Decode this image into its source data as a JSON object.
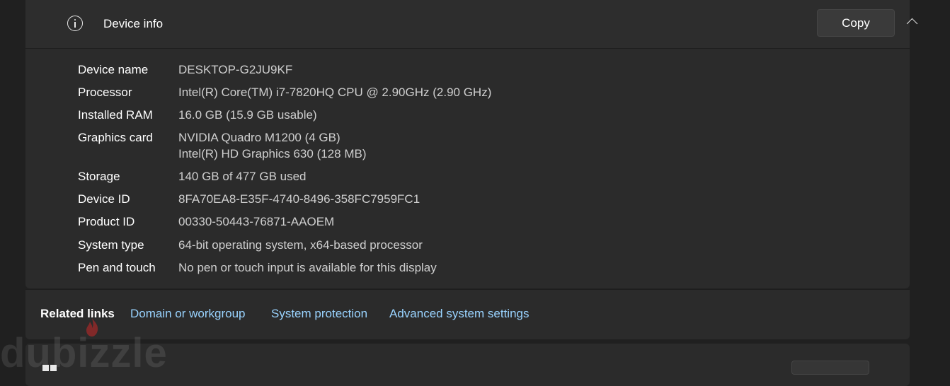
{
  "header": {
    "title": "Device info",
    "copy_label": "Copy",
    "icon": "info-icon",
    "collapse_icon": "chevron-up-icon"
  },
  "specs": [
    {
      "label": "Device name",
      "values": [
        "DESKTOP-G2JU9KF"
      ]
    },
    {
      "label": "Processor",
      "values": [
        "Intel(R) Core(TM) i7-7820HQ CPU @ 2.90GHz (2.90 GHz)"
      ]
    },
    {
      "label": "Installed RAM",
      "values": [
        "16.0 GB (15.9 GB usable)"
      ]
    },
    {
      "label": "Graphics card",
      "values": [
        "NVIDIA Quadro M1200 (4 GB)",
        "Intel(R) HD Graphics 630 (128 MB)"
      ]
    },
    {
      "label": "Storage",
      "values": [
        "140 GB of 477 GB used"
      ]
    },
    {
      "label": "Device ID",
      "values": [
        "8FA70EA8-E35F-4740-8496-358FC7959FC1"
      ]
    },
    {
      "label": "Product ID",
      "values": [
        "00330-50443-76871-AAOEM"
      ]
    },
    {
      "label": "System type",
      "values": [
        "64-bit operating system, x64-based processor"
      ]
    },
    {
      "label": "Pen and touch",
      "values": [
        "No pen or touch input is available for this display"
      ]
    }
  ],
  "related": {
    "title": "Related links",
    "links": [
      "Domain or workgroup",
      "System protection",
      "Advanced system settings"
    ]
  },
  "watermark": "dubizzle",
  "colors": {
    "background": "#202020",
    "card": "#2b2b2b",
    "link": "#99d3ff",
    "value_text": "#cfcfcf"
  }
}
